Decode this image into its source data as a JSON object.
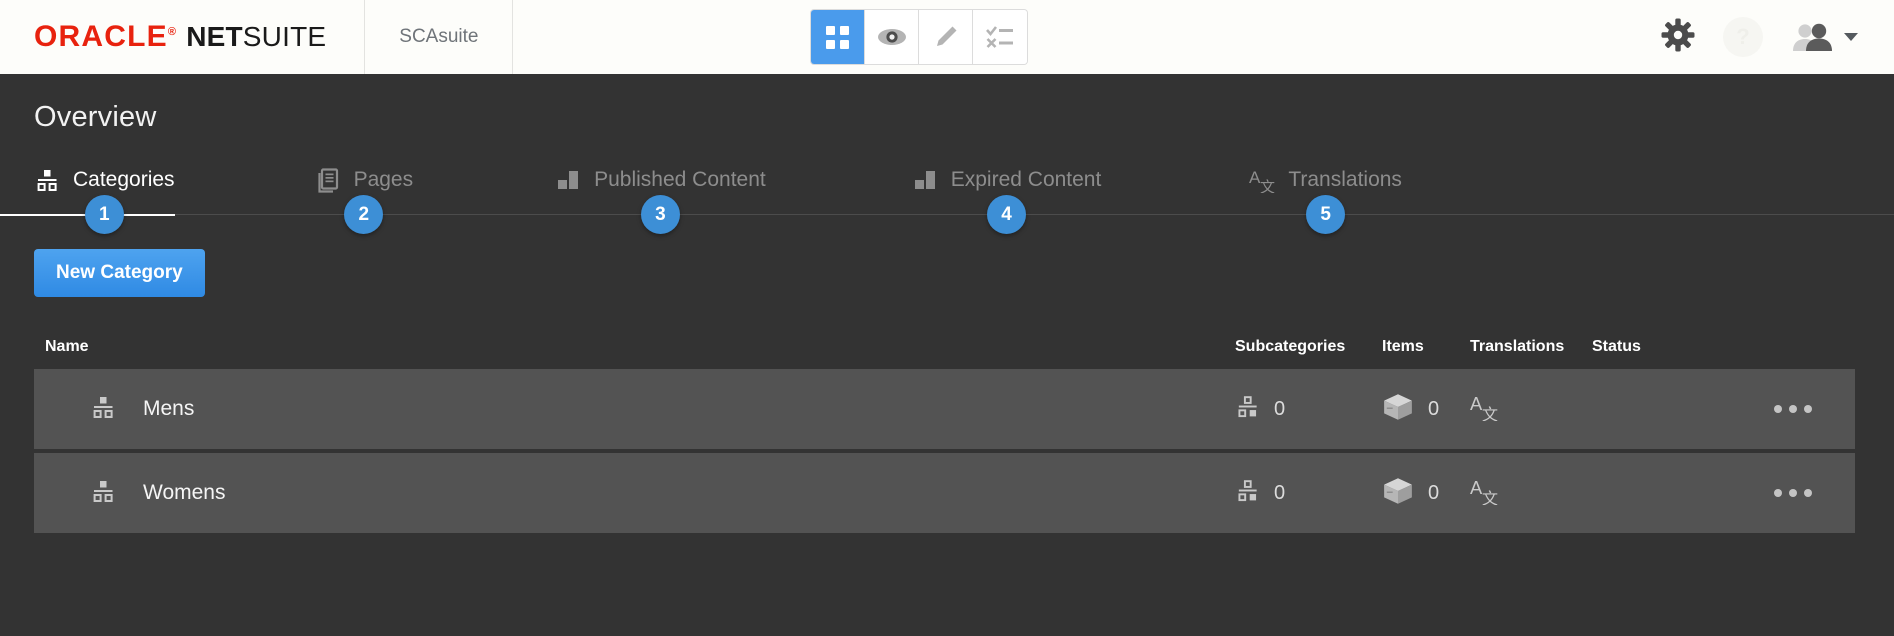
{
  "topbar": {
    "logo_oracle": "ORACLE",
    "logo_reg": "®",
    "logo_net": "NET",
    "logo_suite": "SUITE",
    "account_name": "SCAsuite",
    "tools": [
      {
        "name": "grid-view-button",
        "icon": "grid-icon",
        "active": true
      },
      {
        "name": "preview-button",
        "icon": "eye-icon",
        "active": false
      },
      {
        "name": "edit-button",
        "icon": "pencil-icon",
        "active": false
      },
      {
        "name": "tasks-button",
        "icon": "checklist-icon",
        "active": false
      }
    ],
    "settings_icon": "gear-icon",
    "help_icon": "help-icon",
    "help_label": "?",
    "user_icon": "users-icon",
    "user_caret": "chevron-down-icon",
    "accent_blue": "#4a9bec"
  },
  "page": {
    "title": "Overview"
  },
  "tabs": [
    {
      "label": "Categories",
      "icon": "sitemap-icon",
      "badge": "1",
      "active": true
    },
    {
      "label": "Pages",
      "icon": "pages-icon",
      "badge": "2",
      "active": false
    },
    {
      "label": "Published Content",
      "icon": "blocks-icon",
      "badge": "3",
      "active": false
    },
    {
      "label": "Expired Content",
      "icon": "blocks-icon",
      "badge": "4",
      "active": false
    },
    {
      "label": "Translations",
      "icon": "translate-icon",
      "badge": "5",
      "active": false
    }
  ],
  "toolbar": {
    "new_category_label": "New Category"
  },
  "table": {
    "headers": {
      "name": "Name",
      "subcategories": "Subcategories",
      "items": "Items",
      "translations": "Translations",
      "status": "Status"
    },
    "rows": [
      {
        "name": "Mens",
        "name_icon": "sitemap-icon",
        "subcategories_icon": "sitemap-icon",
        "subcategories": "0",
        "items_icon": "box-icon",
        "items": "0",
        "translations_icon": "translate-icon",
        "status": "",
        "menu_icon": "more-options-icon"
      },
      {
        "name": "Womens",
        "name_icon": "sitemap-icon",
        "subcategories_icon": "sitemap-icon",
        "subcategories": "0",
        "items_icon": "box-icon",
        "items": "0",
        "translations_icon": "translate-icon",
        "status": "",
        "menu_icon": "more-options-icon"
      }
    ]
  },
  "colors": {
    "page_bg": "#333333",
    "row_bg": "#535353",
    "badge_blue": "#3d8fd6",
    "button_blue": "#3d93e8",
    "oracle_red": "#e8220e"
  }
}
